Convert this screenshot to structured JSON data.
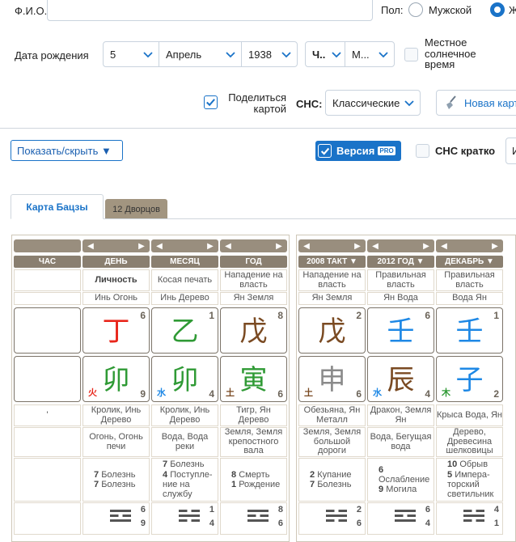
{
  "form": {
    "fio_label": "Ф.И.О.",
    "fio_value": "",
    "sex_label": "Пол:",
    "male_label": "Мужской",
    "female_label": "Ж",
    "birth_label": "Дата рождения",
    "day": "5",
    "month": "Апрель",
    "year": "1938",
    "hour": "Ч..",
    "minute": "М...",
    "local_time_label": "Местное солнечное время",
    "share_label": "Поделиться картой",
    "shs_label": "СНС:",
    "shs_value": "Классические",
    "new_card": "Новая карт"
  },
  "toolbar": {
    "show_hide": "Показать/скрыть ▼",
    "version": "Версия",
    "pro": "PRO",
    "shs_short": "СНС кратко",
    "cut_letter": "И"
  },
  "tabs": {
    "bazi": "Карта Бацзы",
    "palaces": "12 Дворцов"
  },
  "natal": {
    "headers": [
      "ЧАС",
      "ДЕНЬ",
      "МЕСЯЦ",
      "ГОД"
    ],
    "roles": [
      "",
      "Личность",
      "Косая печать",
      "Нападение на власть"
    ],
    "stem_elems": [
      "",
      "Инь Огонь",
      "Инь Дерево",
      "Ян Земля"
    ],
    "stems": [
      "",
      "丁",
      "乙",
      "戊"
    ],
    "stem_nums": [
      "",
      "6",
      "1",
      "8"
    ],
    "branches": [
      "",
      "卯",
      "卯",
      "寅"
    ],
    "branch_nums": [
      "",
      "9",
      "4",
      "6"
    ],
    "branch_elems": [
      "",
      "火",
      "水",
      "土"
    ],
    "animals": [
      "'",
      "Кролик, Инь Дерево",
      "Кролик, Инь Дерево",
      "Тигр, Ян Дерево"
    ],
    "nayin": [
      "",
      "Огонь, Огонь печи",
      "Вода, Вода реки",
      "Земля, Земля крепостного вала"
    ],
    "deities": [
      [],
      [
        [
          "7",
          "Болезнь"
        ],
        [
          "7",
          "Болезнь"
        ]
      ],
      [
        [
          "7",
          "Болезнь"
        ],
        [
          "4",
          "Поступле-ние на службу"
        ]
      ],
      [
        [
          "8",
          "Смерть"
        ],
        [
          "1",
          "Рождение"
        ]
      ]
    ],
    "trig_nums": [
      [
        "",
        ""
      ],
      [
        "6",
        "9"
      ],
      [
        "1",
        "4"
      ],
      [
        "8",
        "6"
      ]
    ]
  },
  "luck": {
    "headers": [
      "2008 ТАКТ ▼",
      "2012 ГОД ▼",
      "ДЕКАБРЬ ▼"
    ],
    "roles": [
      "Нападение на власть",
      "Правильная власть",
      "Правильная власть"
    ],
    "stem_elems": [
      "Ян Земля",
      "Ян Вода",
      "Вода Ян"
    ],
    "stems": [
      "戊",
      "壬",
      "壬"
    ],
    "stem_nums": [
      "2",
      "6",
      "1"
    ],
    "branches": [
      "申",
      "辰",
      "子"
    ],
    "branch_nums": [
      "6",
      "4",
      "2"
    ],
    "branch_elems": [
      "土",
      "水",
      "木"
    ],
    "animals": [
      "Обезьяна, Ян Металл",
      "Дракон, Земля Ян",
      "Крыса Вода, Ян"
    ],
    "nayin": [
      "Земля, Земля большой дороги",
      "Вода, Бегущая вода",
      "Дерево, Древесина шелковицы"
    ],
    "deities": [
      [
        [
          "2",
          "Купание"
        ],
        [
          "7",
          "Болезнь"
        ]
      ],
      [
        [
          "6",
          "Ослабление"
        ],
        [
          "9",
          "Могила"
        ]
      ],
      [
        [
          "10",
          "Обрыв"
        ],
        [
          "5",
          "Импера-торский светильник"
        ]
      ]
    ],
    "trig_nums": [
      [
        "2",
        "6"
      ],
      [
        "6",
        "4"
      ],
      [
        "4",
        "1"
      ]
    ]
  },
  "colors": {
    "fire": "#e8261b",
    "wood": "#2f9a35",
    "earth": "#7a4a22",
    "water": "#1e88e5",
    "metal": "#8a8a8a",
    "accent": "#1a73c8"
  }
}
